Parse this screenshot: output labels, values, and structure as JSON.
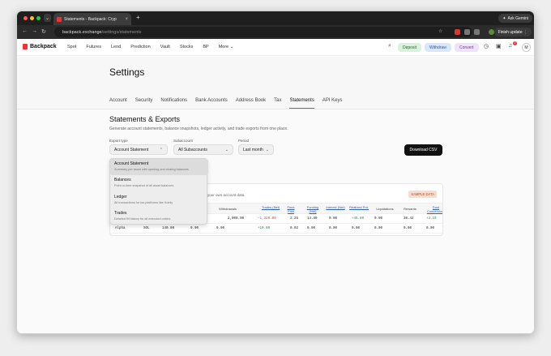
{
  "browser": {
    "tab_title": "Statements - Backpack: Cryp",
    "tab_close": "×",
    "new_tab": "+",
    "ask_gemini": "Ask Gemini",
    "url_host": "backpack.exchange",
    "url_path": "/settings/statements",
    "finish_update": "Finish update"
  },
  "site": {
    "brand": "Backpack",
    "nav": [
      "Spot",
      "Futures",
      "Lend",
      "Prediction",
      "Vault",
      "Stocks",
      "BP",
      "More"
    ],
    "deposit": "Deposit",
    "withdraw": "Withdraw",
    "convert": "Convert",
    "notif_count": "2",
    "avatar": "M"
  },
  "settings": {
    "title": "Settings",
    "tabs": [
      "Account",
      "Security",
      "Notifications",
      "Bank Accounts",
      "Address Book",
      "Tax",
      "Statements",
      "API Keys"
    ],
    "active_tab": "Statements"
  },
  "statements": {
    "heading": "Statements & Exports",
    "subtitle": "Generate account statements, balance snapshots, ledger activity, and trade exports from one place.",
    "export_type_label": "Export type",
    "export_type_value": "Account Statement",
    "subaccount_label": "Subaccount",
    "subaccount_value": "All Subaccounts",
    "period_label": "Period",
    "period_value": "Last month",
    "download": "Download CSV"
  },
  "dropdown": [
    {
      "title": "Account Statement",
      "desc": "Summary per asset with opening and closing balances"
    },
    {
      "title": "Balances",
      "desc": "Point-in-time snapshot of all asset balances"
    },
    {
      "title": "Ledger",
      "desc": "All transactions for tax platforms like Koinly"
    },
    {
      "title": "Trades",
      "desc": "Detailed fill history for all executed orders"
    }
  ],
  "table": {
    "note": "your own account data.",
    "sample": "SAMPLE DATA",
    "headers": [
      "Withdrawals",
      "Trades (Net)",
      "Fees Paid",
      "Funding (Net)",
      "Interest (Net)",
      "Realized PnL",
      "Liquidations",
      "Rewards",
      "Dust Conversions"
    ],
    "rows": [
      [
        "",
        "",
        "",
        "",
        "2,000.00",
        "-1,320.00",
        "2.26",
        "14.80",
        "0.00",
        "+45.80",
        "0.00",
        "30.42",
        "+3.10"
      ],
      [
        "Alpha",
        "SOL",
        "140.00",
        "0.00",
        "0.00",
        "+10.00",
        "0.02",
        "0.00",
        "0.00",
        "0.00",
        "0.00",
        "0.00",
        "0.00"
      ]
    ]
  }
}
